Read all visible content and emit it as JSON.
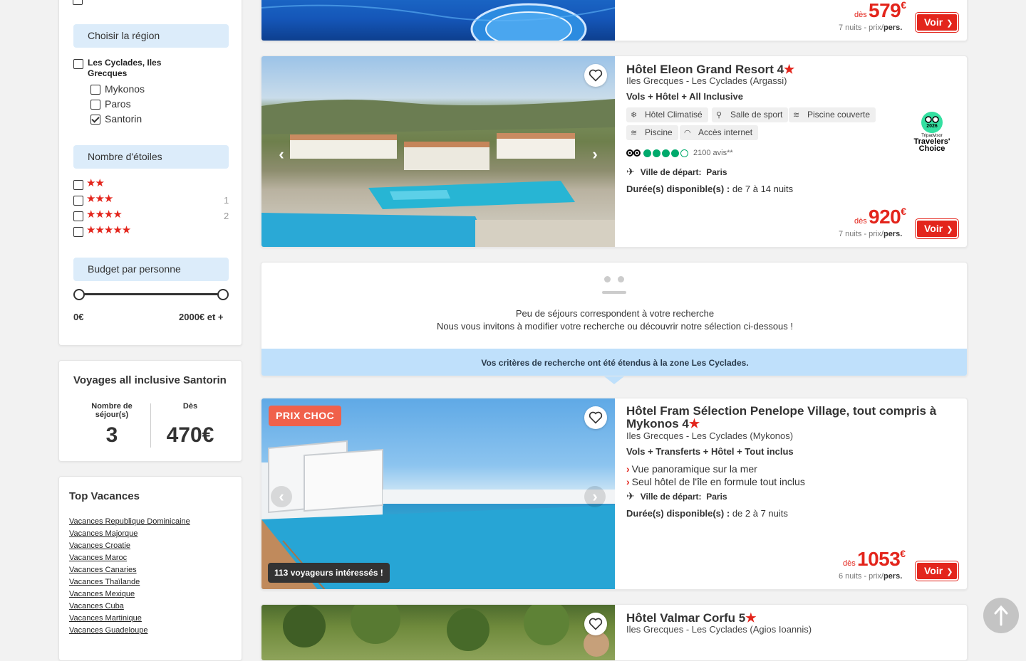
{
  "filters": {
    "region_header": "Choisir la région",
    "region_group": "Les Cyclades, Iles Grecques",
    "region_items": [
      {
        "label": "Mykonos",
        "checked": false
      },
      {
        "label": "Paros",
        "checked": false
      },
      {
        "label": "Santorin",
        "checked": true
      }
    ],
    "stars_header": "Nombre d'étoiles",
    "star_rows": [
      {
        "stars": "★★",
        "count": ""
      },
      {
        "stars": "★★★",
        "count": "1"
      },
      {
        "stars": "★★★★",
        "count": "2"
      },
      {
        "stars": "★★★★★",
        "count": ""
      }
    ],
    "budget_header": "Budget par personne",
    "budget_min": "0€",
    "budget_max": "2000€ et +"
  },
  "summary": {
    "title": "Voyages all inclusive Santorin",
    "count_label": "Nombre de séjour(s)",
    "count_value": "3",
    "from_label": "Dès",
    "from_value": "470€"
  },
  "top_vacances": {
    "title": "Top Vacances",
    "links": [
      "Vacances Republique Dominicaine",
      "Vacances Majorque",
      "Vacances Croatie",
      "Vacances Maroc",
      "Vacances Canaries",
      "Vacances Thaïlande",
      "Vacances Mexique",
      "Vacances Cuba",
      "Vacances Martinique",
      "Vacances Guadeloupe"
    ]
  },
  "card0": {
    "des": "dès",
    "price": "579",
    "currency": "€",
    "nights": "7 nuits - prix/",
    "per": "pers.",
    "voir": "Voir"
  },
  "card1": {
    "name": "Hôtel Eleon Grand Resort 4",
    "star": "★",
    "location": "Iles Grecques - Les Cyclades (Argassi)",
    "formula": "Vols + Hôtel + All Inclusive",
    "amenities": [
      "Hôtel Climatisé",
      "Salle de sport",
      "Piscine couverte",
      "Piscine",
      "Accès internet"
    ],
    "reviews": "2100 avis**",
    "depart_label": "Ville de départ:",
    "depart_city": "Paris",
    "duree_label": "Durée(s) disponible(s) :",
    "duree_value": "de 7 à 14 nuits",
    "badge_year": "2026",
    "badge_brand": "Tripadvisor",
    "badge_line1": "Travelers'",
    "badge_line2": "Choice",
    "des": "dès",
    "price": "920",
    "currency": "€",
    "nights": "7 nuits - prix/",
    "per": "pers.",
    "voir": "Voir"
  },
  "notice": {
    "line1": "Peu de séjours correspondent à votre recherche",
    "line2": "Nous vous invitons à modifier votre recherche ou découvrir notre sélection ci-dessous !",
    "extended": "Vos critères de recherche ont été étendus à la zone Les Cyclades."
  },
  "card2": {
    "tag": "PRIX CHOC",
    "interested": "113 voyageurs intéressés !",
    "name": "Hôtel Fram Sélection Penelope Village, tout compris à Mykonos 4",
    "star": "★",
    "location": "Iles Grecques - Les Cyclades (Mykonos)",
    "formula": "Vols + Transferts + Hôtel + Tout inclus",
    "selling": [
      "Vue panoramique sur la mer",
      "Seul hôtel de l'île en formule tout inclus"
    ],
    "depart_label": "Ville de départ:",
    "depart_city": "Paris",
    "duree_label": "Durée(s) disponible(s) :",
    "duree_value": "de 2 à 7 nuits",
    "des": "dès",
    "price": "1053",
    "currency": "€",
    "nights": "6 nuits - prix/",
    "per": "pers.",
    "voir": "Voir"
  },
  "card3": {
    "name": "Hôtel Valmar Corfu 5",
    "star": "★",
    "location": "Iles Grecques - Les Cyclades (Agios Ioannis)"
  },
  "colors": {
    "accent": "#e3251c",
    "filter_bg": "#dcecfa",
    "notice_bar": "#bfe0fb",
    "tag": "#f0614b"
  },
  "icons": [
    "heart-icon",
    "chevron-left-icon",
    "chevron-right-icon",
    "arrow-up-icon",
    "plane-icon",
    "tripadvisor-owl-icon"
  ]
}
